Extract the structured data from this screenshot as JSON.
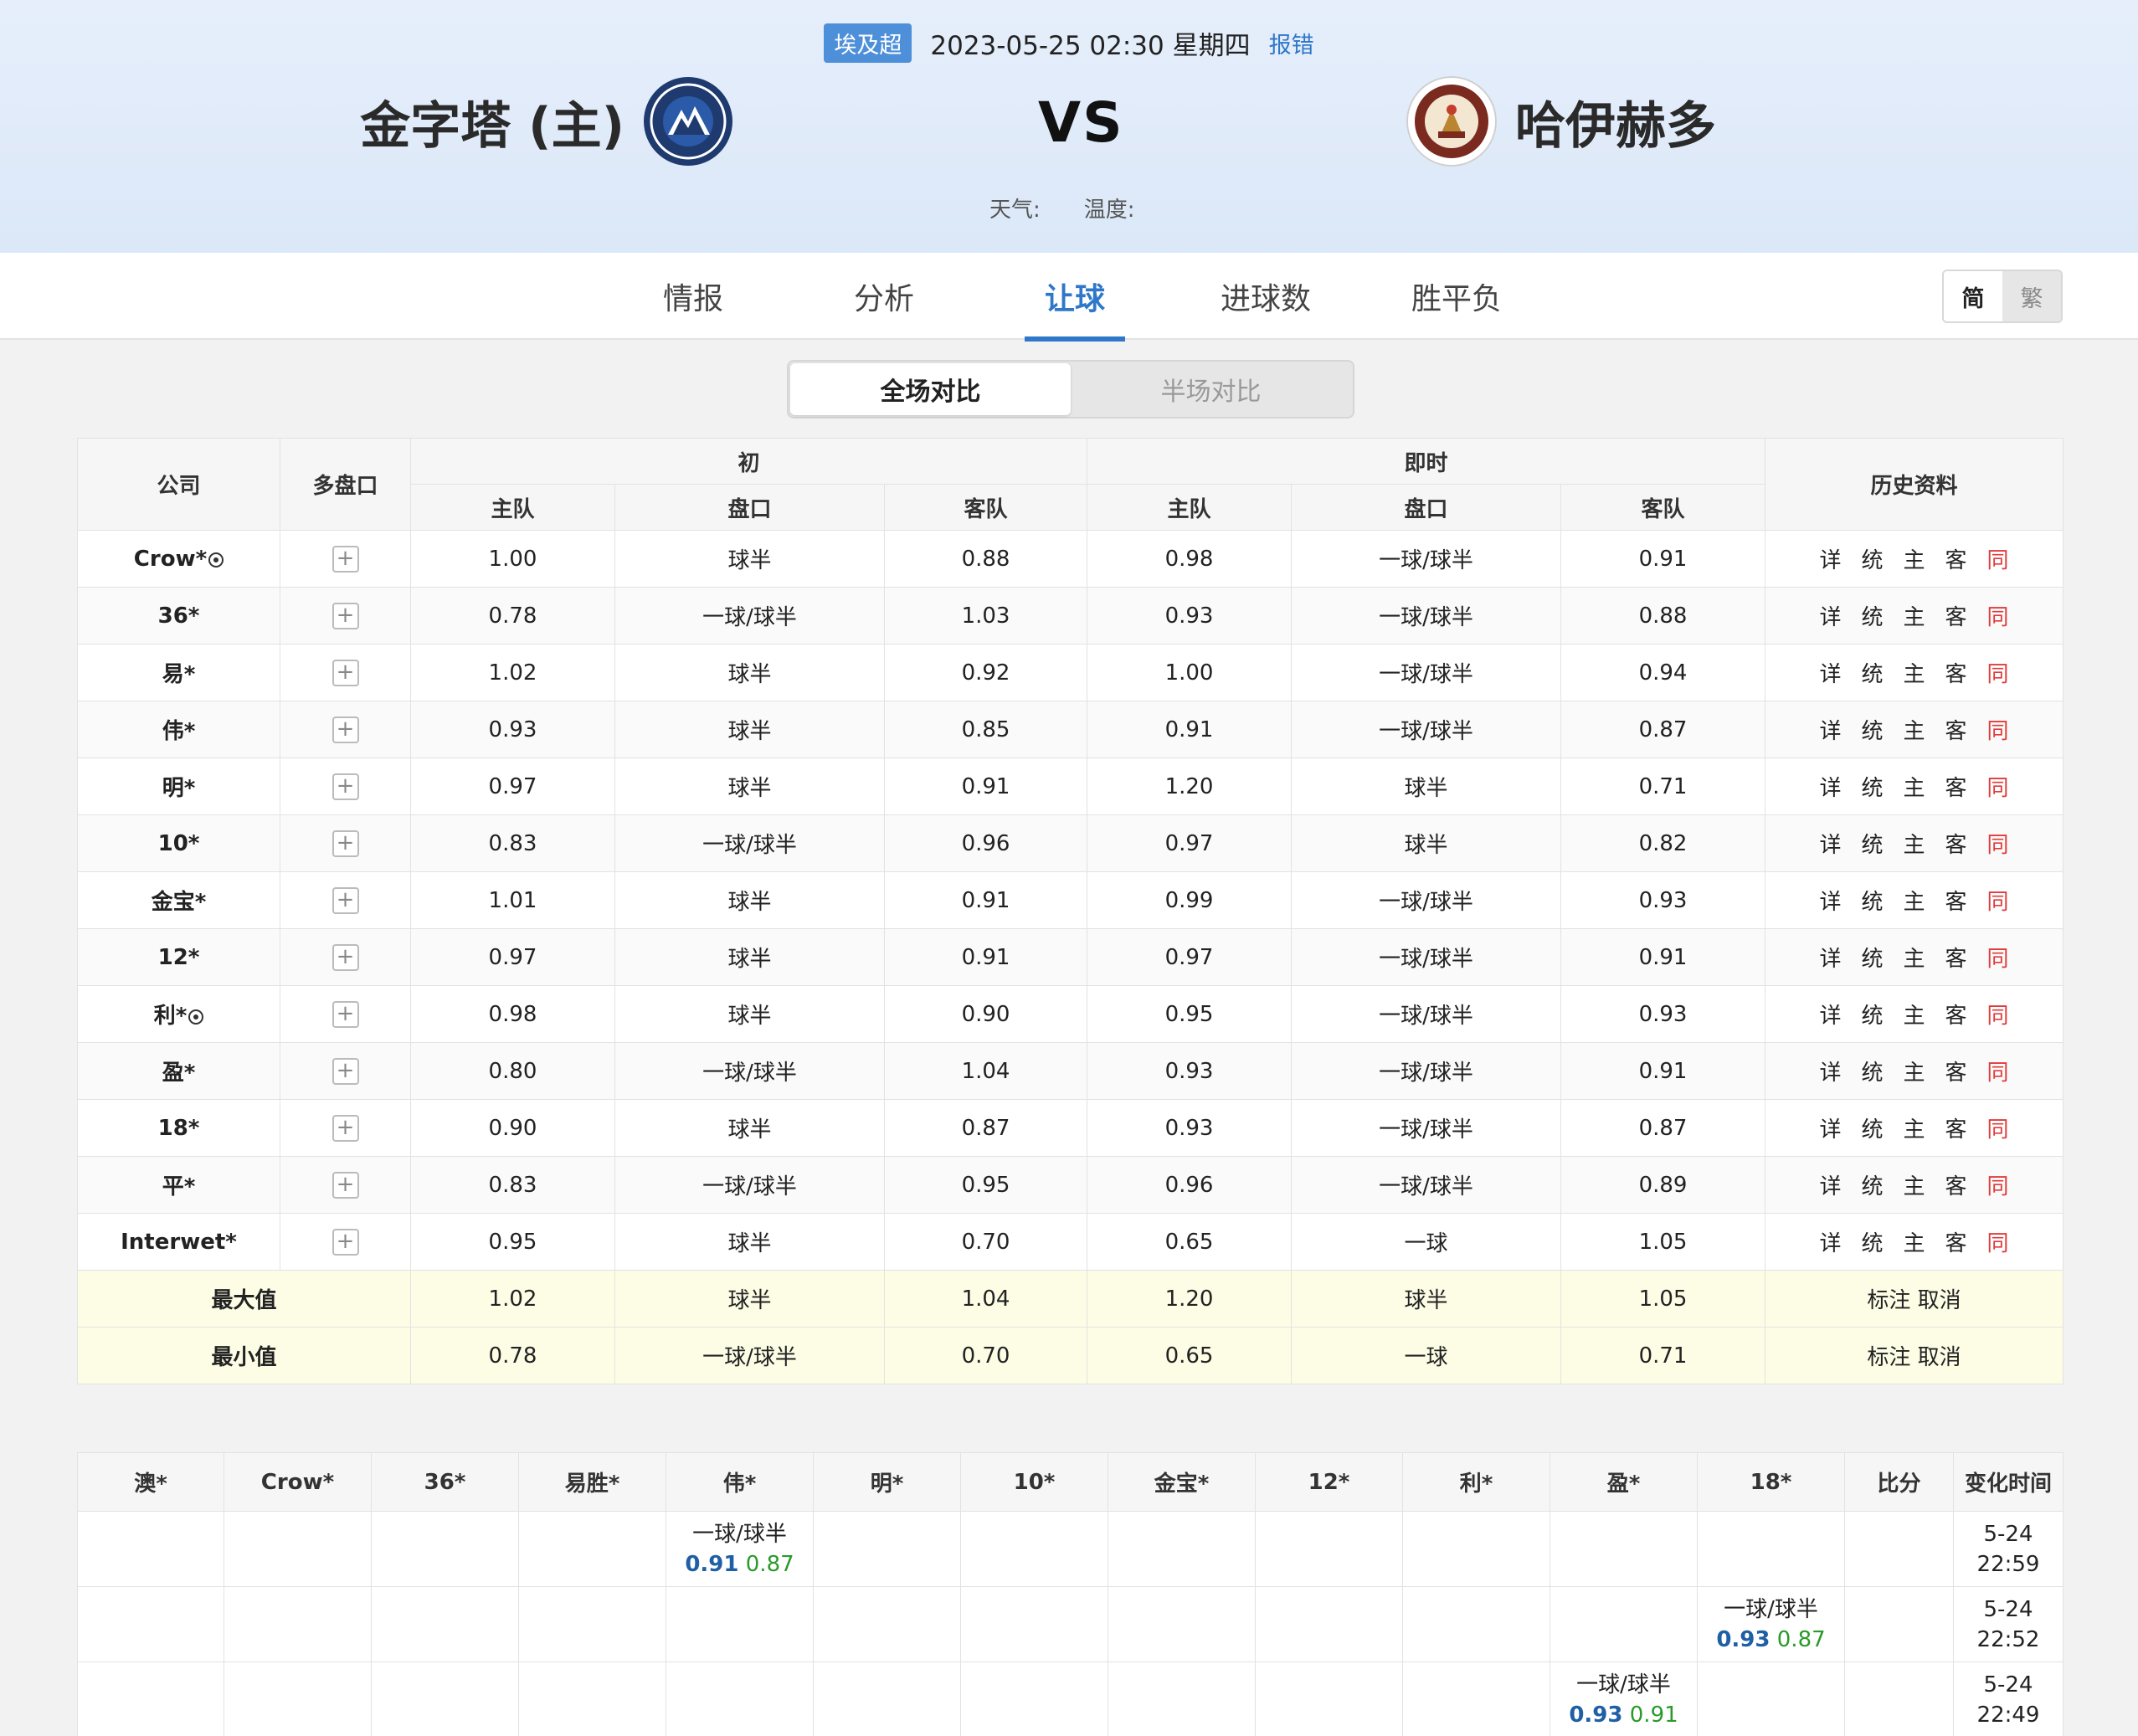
{
  "header": {
    "league": "埃及超",
    "datetime": "2023-05-25 02:30 星期四",
    "report": "报错",
    "home": "金字塔 (主)",
    "away": "哈伊赫多",
    "vs": "VS",
    "weather_label": "天气:",
    "temp_label": "温度:"
  },
  "tabs": [
    "情报",
    "分析",
    "让球",
    "进球数",
    "胜平负"
  ],
  "active_tab": "让球",
  "lang": {
    "simplified": "简",
    "traditional": "繁"
  },
  "segment": {
    "full": "全场对比",
    "half": "半场对比"
  },
  "odds_table": {
    "headers": {
      "company": "公司",
      "multi": "多盘口",
      "initial": "初",
      "live": "即时",
      "history": "历史资料",
      "home": "主队",
      "line": "盘口",
      "away": "客队"
    },
    "history_links": [
      "详",
      "统",
      "主",
      "客",
      "同"
    ],
    "rows": [
      {
        "company": "Crow*",
        "ball": true,
        "i_home": "1.00",
        "i_line": "球半",
        "i_away": "0.88",
        "l_home": "0.98",
        "l_line": "一球/球半",
        "l_away": "0.91"
      },
      {
        "company": "36*",
        "ball": false,
        "i_home": "0.78",
        "i_line": "一球/球半",
        "i_away": "1.03",
        "l_home": "0.93",
        "l_line": "一球/球半",
        "l_away": "0.88"
      },
      {
        "company": "易*",
        "ball": false,
        "i_home": "1.02",
        "i_line": "球半",
        "i_away": "0.92",
        "l_home": "1.00",
        "l_line": "一球/球半",
        "l_away": "0.94"
      },
      {
        "company": "伟*",
        "ball": false,
        "i_home": "0.93",
        "i_line": "球半",
        "i_away": "0.85",
        "l_home": "0.91",
        "l_line": "一球/球半",
        "l_away": "0.87"
      },
      {
        "company": "明*",
        "ball": false,
        "i_home": "0.97",
        "i_line": "球半",
        "i_away": "0.91",
        "l_home": "1.20",
        "l_line": "球半",
        "l_away": "0.71"
      },
      {
        "company": "10*",
        "ball": false,
        "i_home": "0.83",
        "i_line": "一球/球半",
        "i_away": "0.96",
        "l_home": "0.97",
        "l_line": "球半",
        "l_away": "0.82"
      },
      {
        "company": "金宝*",
        "ball": false,
        "i_home": "1.01",
        "i_line": "球半",
        "i_away": "0.91",
        "l_home": "0.99",
        "l_line": "一球/球半",
        "l_away": "0.93"
      },
      {
        "company": "12*",
        "ball": false,
        "i_home": "0.97",
        "i_line": "球半",
        "i_away": "0.91",
        "l_home": "0.97",
        "l_line": "一球/球半",
        "l_away": "0.91"
      },
      {
        "company": "利*",
        "ball": true,
        "i_home": "0.98",
        "i_line": "球半",
        "i_away": "0.90",
        "l_home": "0.95",
        "l_line": "一球/球半",
        "l_away": "0.93"
      },
      {
        "company": "盈*",
        "ball": false,
        "i_home": "0.80",
        "i_line": "一球/球半",
        "i_away": "1.04",
        "l_home": "0.93",
        "l_line": "一球/球半",
        "l_away": "0.91"
      },
      {
        "company": "18*",
        "ball": false,
        "i_home": "0.90",
        "i_line": "球半",
        "i_away": "0.87",
        "l_home": "0.93",
        "l_line": "一球/球半",
        "l_away": "0.87"
      },
      {
        "company": "平*",
        "ball": false,
        "i_home": "0.83",
        "i_line": "一球/球半",
        "i_away": "0.95",
        "l_home": "0.96",
        "l_line": "一球/球半",
        "l_away": "0.89"
      },
      {
        "company": "Interwet*",
        "ball": false,
        "i_home": "0.95",
        "i_line": "球半",
        "i_away": "0.70",
        "l_home": "0.65",
        "l_line": "一球",
        "l_away": "1.05"
      }
    ],
    "summary": [
      {
        "label": "最大值",
        "i_home": "1.02",
        "i_line": "球半",
        "i_away": "1.04",
        "l_home": "1.20",
        "l_line": "球半",
        "l_away": "1.05"
      },
      {
        "label": "最小值",
        "i_home": "0.78",
        "i_line": "一球/球半",
        "i_away": "0.70",
        "l_home": "0.65",
        "l_line": "一球",
        "l_away": "0.71"
      }
    ],
    "mark": "标注",
    "cancel": "取消"
  },
  "changes_table": {
    "headers": [
      "澳*",
      "Crow*",
      "36*",
      "易胜*",
      "伟*",
      "明*",
      "10*",
      "金宝*",
      "12*",
      "利*",
      "盈*",
      "18*",
      "比分",
      "变化时间"
    ],
    "rows": [
      {
        "col": 4,
        "line": "一球/球半",
        "home": "0.91",
        "away": "0.87",
        "time": "5-24 22:59"
      },
      {
        "col": 11,
        "line": "一球/球半",
        "home": "0.93",
        "away": "0.87",
        "time": "5-24 22:52"
      },
      {
        "col": 10,
        "line": "一球/球半",
        "home": "0.93",
        "away": "0.91",
        "time": "5-24 22:49"
      }
    ]
  },
  "colors": {
    "accent": "#2f77c9",
    "badge": "#4d8fd8",
    "same_link": "#e03a3a",
    "summary_bg": "#fdfde6",
    "home_odds": "#1f5fa5",
    "away_odds": "#2a9a2a"
  }
}
